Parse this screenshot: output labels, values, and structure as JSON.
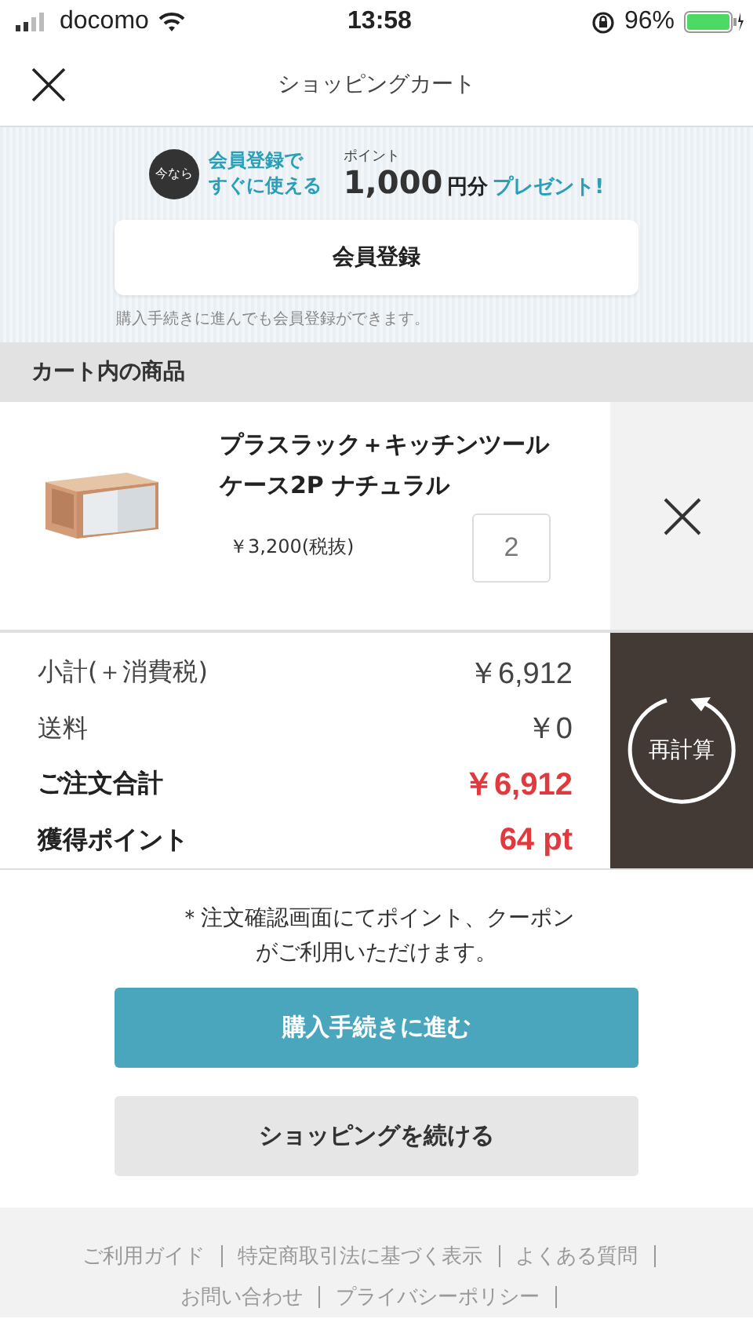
{
  "status_bar": {
    "carrier": "docomo",
    "time": "13:58",
    "battery": "96%"
  },
  "header": {
    "title": "ショッピングカート"
  },
  "promo": {
    "badge": "今なら",
    "lead": [
      "会員登録で",
      "すぐに使える"
    ],
    "points_label": "ポイント",
    "amount": "1,000",
    "unit": "円分",
    "present": "プレゼント!",
    "button": "会員登録",
    "note": "購入手続きに進んでも会員登録ができます。"
  },
  "section_title": "カート内の商品",
  "items": [
    {
      "kind": "picture",
      "name": "プラスラック＋キッチンツールケース2P ナチュラル",
      "price": "￥3,200(税抜)",
      "quantity": "2"
    }
  ],
  "totals": [
    {
      "label": "小計(＋消費税)",
      "value": "￥6,912",
      "emphasis": false
    },
    {
      "label": "送料",
      "value": "￥0",
      "emphasis": false
    },
    {
      "label": "ご注文合計",
      "value": "￥6,912",
      "emphasis": true
    },
    {
      "label": "獲得ポイント",
      "value": "64 pt",
      "emphasis": true
    }
  ],
  "recalc_button": "再計算",
  "notice": "＊注文確認画面にてポイント、クーポンがご利用いただけます。",
  "buttons": [
    {
      "label": "購入手続きに進む",
      "kind": "primary"
    },
    {
      "label": "ショッピングを続ける",
      "kind": "secondary"
    }
  ],
  "footer_links": [
    [
      "ご利用ガイド",
      "特定商取引法に基づく表示",
      "よくある質問"
    ],
    [
      "お問い合わせ",
      "プライバシーポリシー"
    ]
  ]
}
